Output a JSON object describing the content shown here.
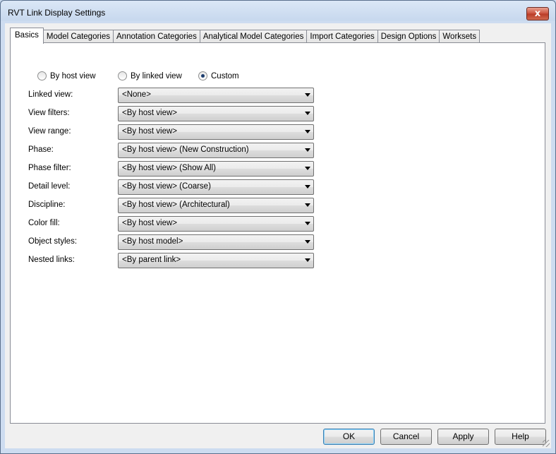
{
  "window": {
    "title": "RVT Link Display Settings",
    "close_glyph": "x"
  },
  "tabs": [
    {
      "label": "Basics",
      "active": true
    },
    {
      "label": "Model Categories"
    },
    {
      "label": "Annotation Categories"
    },
    {
      "label": "Analytical Model Categories"
    },
    {
      "label": "Import Categories"
    },
    {
      "label": "Design Options"
    },
    {
      "label": "Worksets"
    }
  ],
  "mode": {
    "options": [
      "By host view",
      "By linked view",
      "Custom"
    ],
    "selected": "Custom"
  },
  "fields": [
    {
      "label": "Linked view:",
      "value": "<None>"
    },
    {
      "label": "View filters:",
      "value": "<By host view>"
    },
    {
      "label": "View range:",
      "value": "<By host view>"
    },
    {
      "label": "Phase:",
      "value": "<By host view> (New Construction)"
    },
    {
      "label": "Phase filter:",
      "value": "<By host view> (Show All)"
    },
    {
      "label": "Detail level:",
      "value": "<By host view> (Coarse)"
    },
    {
      "label": "Discipline:",
      "value": "<By host view> (Architectural)"
    },
    {
      "label": "Color fill:",
      "value": "<By host view>"
    },
    {
      "label": "Object styles:",
      "value": "<By host model>"
    },
    {
      "label": "Nested links:",
      "value": "<By parent link>"
    }
  ],
  "buttons": {
    "ok": "OK",
    "cancel": "Cancel",
    "apply": "Apply",
    "help": "Help"
  }
}
